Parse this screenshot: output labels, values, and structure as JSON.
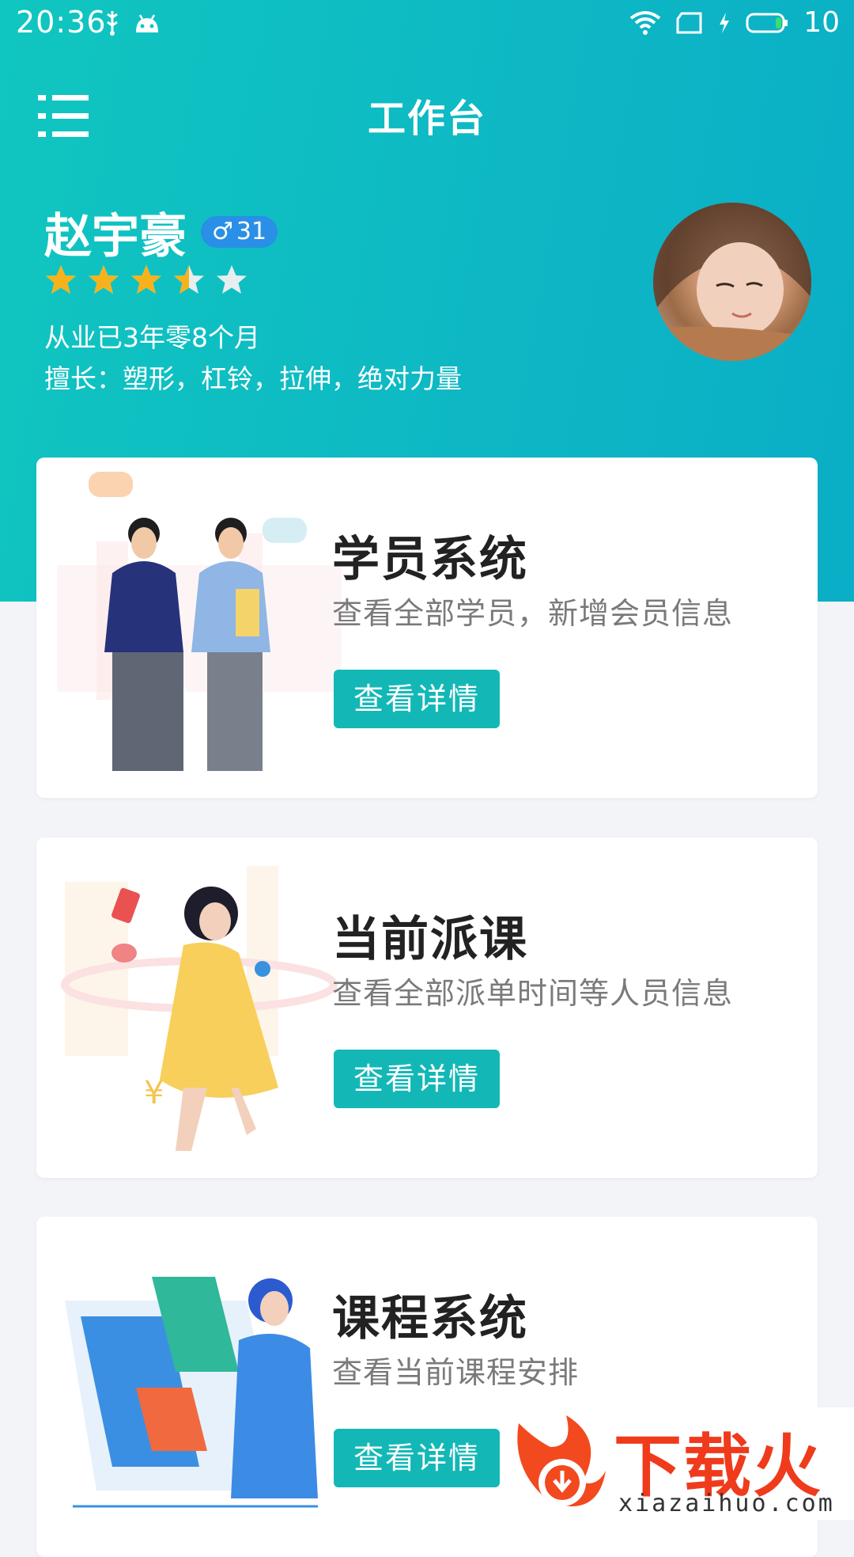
{
  "status_bar": {
    "time": "20:36",
    "battery_level": "10"
  },
  "header": {
    "title": "工作台",
    "menu_icon": "list-menu-icon"
  },
  "profile": {
    "name": "赵宇豪",
    "gender_symbol": "♂",
    "age": "31",
    "rating": 3.5,
    "rating_max": 5,
    "tenure": "从业已3年零8个月",
    "specialty": "擅长：塑形，杠铃，拉伸，绝对力量"
  },
  "cards": [
    {
      "title": "学员系统",
      "description": "查看全部学员，新增会员信息",
      "button": "查看详情"
    },
    {
      "title": "当前派课",
      "description": "查看全部派单时间等人员信息",
      "button": "查看详情"
    },
    {
      "title": "课程系统",
      "description": "查看当前课程安排",
      "button": "查看详情"
    }
  ],
  "watermark": {
    "text": "下载火",
    "url": "xiazaihuo.com"
  },
  "colors": {
    "accent": "#13b8b6",
    "hero_start": "#10c6c0",
    "hero_end": "#0aaec6",
    "star_active": "#f6b21c",
    "star_inactive": "#e6eef0",
    "badge": "#2a8fe6"
  }
}
